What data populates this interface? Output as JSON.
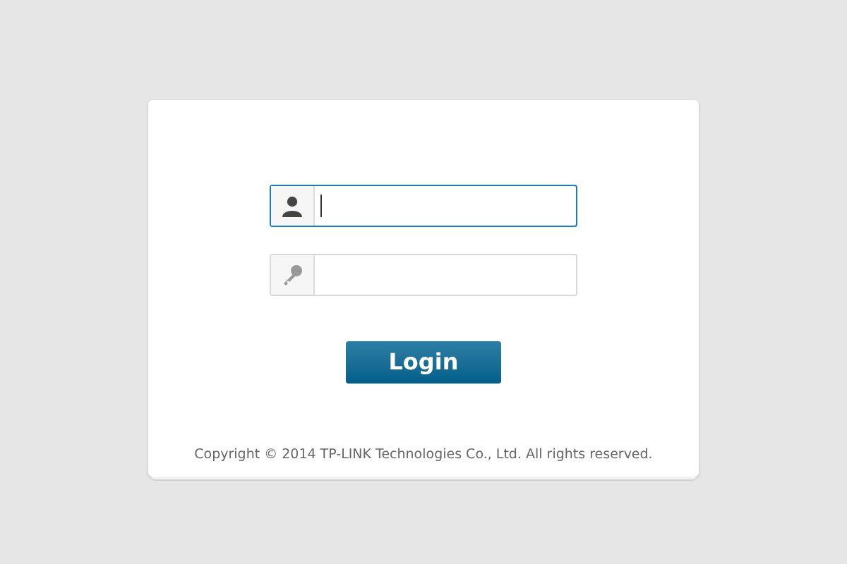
{
  "fields": [
    {
      "kind": "user",
      "focused": true
    },
    {
      "kind": "password",
      "focused": false
    }
  ],
  "login_button": {
    "label": "Login"
  },
  "copyright": "Copyright © 2014 TP-LINK Technologies Co., Ltd. All rights reserved."
}
